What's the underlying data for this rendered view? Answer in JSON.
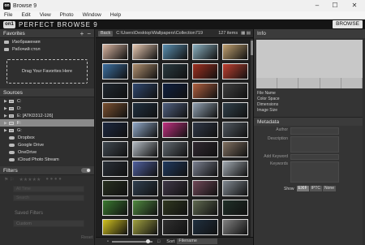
{
  "window": {
    "title": "Browse 9",
    "minimize": "–",
    "maximize": "☐",
    "close": "✕",
    "app_icon": "on"
  },
  "menu": [
    "File",
    "Edit",
    "View",
    "Photo",
    "Window",
    "Help"
  ],
  "brand": {
    "logo": "on1",
    "name": "PERFECT BROWSE 9",
    "browse_button": "BROWSE"
  },
  "favorites": {
    "title": "Favorites",
    "items": [
      "Изображения",
      "Рабочий стол"
    ],
    "drop_label": "Drag Your Favorites Here"
  },
  "sources": {
    "title": "Sources",
    "drives": [
      {
        "label": "C:",
        "selected": false
      },
      {
        "label": "D:",
        "selected": false
      },
      {
        "label": "E: [ATKD312-126]",
        "selected": false
      },
      {
        "label": "F:",
        "selected": true
      },
      {
        "label": "G:",
        "selected": false
      }
    ],
    "cloud": [
      "Dropbox",
      "Google Drive",
      "OneDrive",
      "iCloud Photo Stream"
    ]
  },
  "filters": {
    "title": "Filters",
    "time_placeholder": "All Time",
    "search_placeholder": "Search",
    "saved_title": "Saved Filters",
    "saved_value": "Custom",
    "reset": "Reset"
  },
  "browser": {
    "back": "Back",
    "path": "C:\\Users\\Desktop\\Wallpapers\\Collection719",
    "count": "127 items",
    "sort_label": "Sort",
    "sort_value": "Filename"
  },
  "thumb_colors": [
    [
      "#d8b4a0",
      "#e6c7b0",
      "#5a8fb0",
      "#8ab0c0",
      "#c0a070"
    ],
    [
      "#3c6fa0",
      "#b09070",
      "#2a3a40",
      "#a03020",
      "#c04030"
    ],
    [
      "#202830",
      "#304870",
      "#102040",
      "#b06040",
      "#404040"
    ],
    [
      "#7a5030",
      "#203040",
      "#506080",
      "#90a0b0",
      "#30404a"
    ],
    [
      "#1c2840",
      "#90a8c8",
      "#c03080",
      "#303848",
      "#505860"
    ],
    [
      "#404850",
      "#b0b8c0",
      "#606870",
      "#302830",
      "#807060"
    ],
    [
      "#2a3038",
      "#5060a0",
      "#203a60",
      "#7a8090",
      "#a0a8b0"
    ],
    [
      "#283020",
      "#304050",
      "#403848",
      "#704858",
      "#808890"
    ],
    [
      "#3a7a30",
      "#508a40",
      "#303820",
      "#606a50",
      "#203028"
    ],
    [
      "#d0c020",
      "#a0a040",
      "#303030",
      "#203040",
      "#808080"
    ]
  ],
  "info": {
    "title": "Info",
    "labels": [
      "File Name",
      "Color Space",
      "Dimensions",
      "Image Size"
    ]
  },
  "metadata": {
    "title": "Metadata",
    "fields": [
      "Author",
      "Description",
      "Add Keyword",
      "Keywords"
    ],
    "show_label": "Show",
    "show_options": [
      "EXIF",
      "IPTC",
      "None"
    ],
    "active_option": "EXIF"
  }
}
